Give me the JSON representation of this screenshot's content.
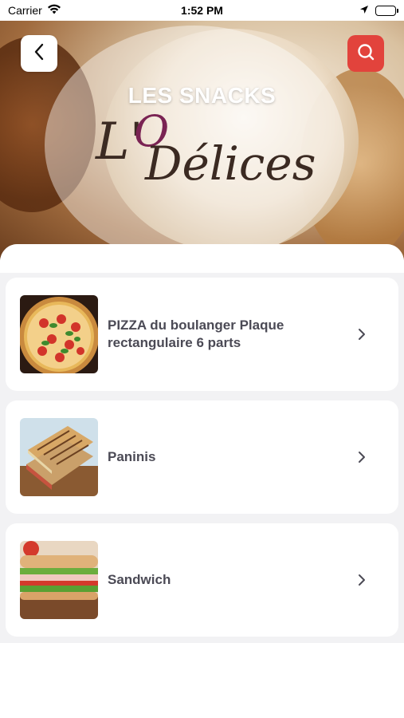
{
  "status_bar": {
    "carrier": "Carrier",
    "time": "1:52 PM"
  },
  "header": {
    "title": "LES SNACKS",
    "logo": "L'O Délices"
  },
  "categories": [
    {
      "label": "PIZZA du boulanger Plaque rectangulaire 6 parts",
      "image": "pizza-image"
    },
    {
      "label": "Paninis",
      "image": "panini-image"
    },
    {
      "label": "Sandwich",
      "image": "sandwich-image"
    }
  ],
  "colors": {
    "accent": "#e2433c",
    "text": "#4b4a55",
    "background": "#f2f2f4"
  }
}
